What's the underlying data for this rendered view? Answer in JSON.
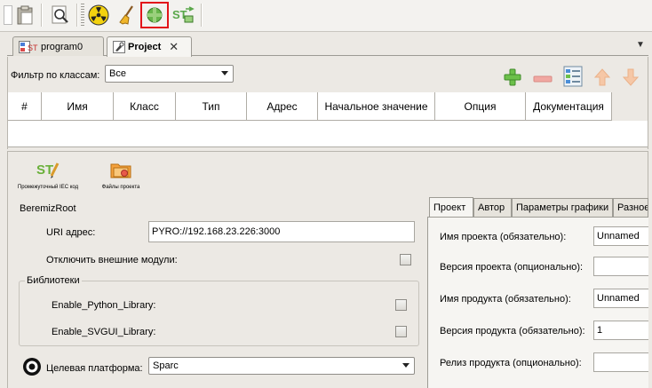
{
  "toolbar": {
    "buttons": [
      {
        "name": "paste-icon"
      },
      {
        "name": "find-icon"
      },
      {
        "name": "clean-build-icon"
      },
      {
        "name": "broom-icon"
      },
      {
        "name": "connect-icon",
        "highlighted": true
      },
      {
        "name": "transfer-icon"
      }
    ],
    "highlight_color": "#e2141a"
  },
  "tabs": [
    {
      "label": "program0",
      "icon": "st-program-icon"
    },
    {
      "label": "Project",
      "icon": "project-icon",
      "active": true
    }
  ],
  "filter": {
    "label": "Фильтр по классам:",
    "value": "Все"
  },
  "variable_actions": [
    "add-icon",
    "remove-icon",
    "edit-columns-icon",
    "move-up-icon",
    "move-down-icon"
  ],
  "grid": {
    "columns": [
      "#",
      "Имя",
      "Класс",
      "Тип",
      "Адрес",
      "Начальное значение",
      "Опция",
      "Документация"
    ]
  },
  "project_tools": [
    {
      "label": "Промежуточный IEC код",
      "icon": "iec-code-icon"
    },
    {
      "label": "Файлы проекта",
      "icon": "project-files-icon"
    }
  ],
  "config": {
    "root_title": "BeremizRoot",
    "uri_label": "URI адрес:",
    "uri_value": "PYRO://192.168.23.226:3000",
    "disable_ext_label": "Отключить внешние модули:",
    "libraries_title": "Библиотеки",
    "libraries": [
      {
        "label": "Enable_Python_Library:"
      },
      {
        "label": "Enable_SVGUI_Library:"
      }
    ],
    "target_label": "Целевая платформа:",
    "target_value": "Sparc"
  },
  "properties": {
    "tabs": [
      "Проект",
      "Автор",
      "Параметры графики",
      "Разное"
    ],
    "fields": [
      {
        "label": "Имя проекта (обязательно):",
        "value": "Unnamed"
      },
      {
        "label": "Версия проекта (опционально):",
        "value": ""
      },
      {
        "label": "Имя продукта (обязательно):",
        "value": "Unnamed"
      },
      {
        "label": "Версия продукта (обязательно):",
        "value": "1"
      },
      {
        "label": "Релиз продукта (опционально):",
        "value": ""
      }
    ]
  }
}
